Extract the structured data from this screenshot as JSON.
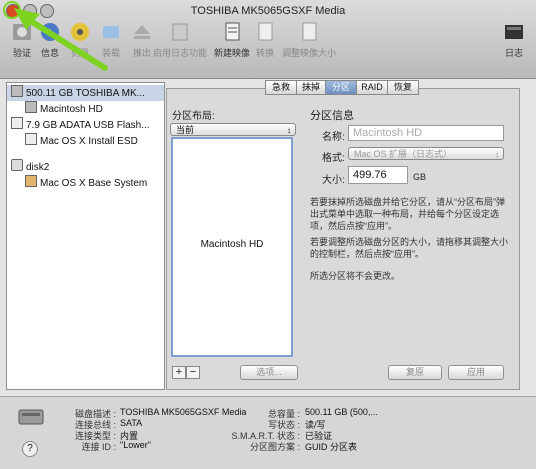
{
  "window": {
    "title": "TOSHIBA MK5065GSXF Media"
  },
  "toolbar": {
    "items": [
      {
        "label": "验证",
        "icon": "verify-icon",
        "enabled": true
      },
      {
        "label": "信息",
        "icon": "info-icon",
        "enabled": true
      },
      {
        "label": "刻录",
        "icon": "burn-icon",
        "enabled": false
      },
      {
        "label": "装载",
        "icon": "mount-icon",
        "enabled": false
      },
      {
        "label": "推出",
        "icon": "eject-icon",
        "enabled": false
      },
      {
        "label": "启用日志功能",
        "icon": "journal-icon",
        "enabled": false
      },
      {
        "label": "新建映像",
        "icon": "new-image-icon",
        "enabled": true
      },
      {
        "label": "转换",
        "icon": "convert-icon",
        "enabled": false
      },
      {
        "label": "调整映像大小",
        "icon": "resize-image-icon",
        "enabled": false
      },
      {
        "label": "日志",
        "icon": "log-icon",
        "enabled": true
      }
    ]
  },
  "sidebar": {
    "items": [
      {
        "label": "500.11 GB TOSHIBA MK...",
        "level": 0,
        "icon": "hard-disk-icon",
        "selected": true
      },
      {
        "label": "Macintosh HD",
        "level": 1,
        "icon": "volume-icon",
        "selected": false
      },
      {
        "label": "7.9 GB ADATA USB Flash...",
        "level": 0,
        "icon": "usb-disk-icon",
        "selected": false
      },
      {
        "label": "Mac OS X Install ESD",
        "level": 1,
        "icon": "volume-icon",
        "selected": false
      },
      {
        "label": "disk2",
        "level": 0,
        "icon": "disk-image-icon",
        "selected": false
      },
      {
        "label": "Mac OS X Base System",
        "level": 1,
        "icon": "volume-icon",
        "selected": false
      }
    ]
  },
  "tabs": [
    {
      "label": "急救",
      "active": false
    },
    {
      "label": "抹掉",
      "active": false
    },
    {
      "label": "分区",
      "active": true
    },
    {
      "label": "RAID",
      "active": false
    },
    {
      "label": "恢复",
      "active": false
    }
  ],
  "partition": {
    "layout_heading": "分区布局:",
    "layout_value": "当前",
    "map_label": "Macintosh HD",
    "info_heading": "分区信息",
    "name_label": "名称:",
    "name_value": "Macintosh HD",
    "format_label": "格式:",
    "format_value": "Mac OS 扩展（日志式）",
    "size_label": "大小:",
    "size_value": "499.76",
    "size_unit": "GB",
    "help1": "若要抹掉所选磁盘并给它分区，请从“分区布局”弹出式菜单中选取一种布局，并给每个分区设定选项，然后点按“应用”。",
    "help2": "若要调整所选磁盘分区的大小，请拖移其调整大小的控制栏，然后点按“应用”。",
    "help3": "所选分区将不会更改。",
    "plus": "+",
    "minus": "−",
    "options_btn": "选项...",
    "revert_btn": "复原",
    "apply_btn": "应用"
  },
  "info": {
    "desc_key": "磁盘描述 :",
    "desc_val": "TOSHIBA MK5065GSXF Media",
    "bus_key": "连接总线 :",
    "bus_val": "SATA",
    "type_key": "连接类型 :",
    "type_val": "内置",
    "id_key": "连接 ID :",
    "id_val": "\"Lower\"",
    "cap_key": "总容量 :",
    "cap_val": "500.11 GB (500,...",
    "write_key": "写状态 :",
    "write_val": "读/写",
    "smart_key": "S.M.A.R.T. 状态 :",
    "smart_val": "已验证",
    "scheme_key": "分区图方案 :",
    "scheme_val": "GUID 分区表"
  },
  "help_button": "?",
  "colors": {
    "arrow": "#7ed321",
    "close": "#d9481f",
    "selection": "#c9d5e6",
    "active_tab": "#6d8fc1"
  }
}
